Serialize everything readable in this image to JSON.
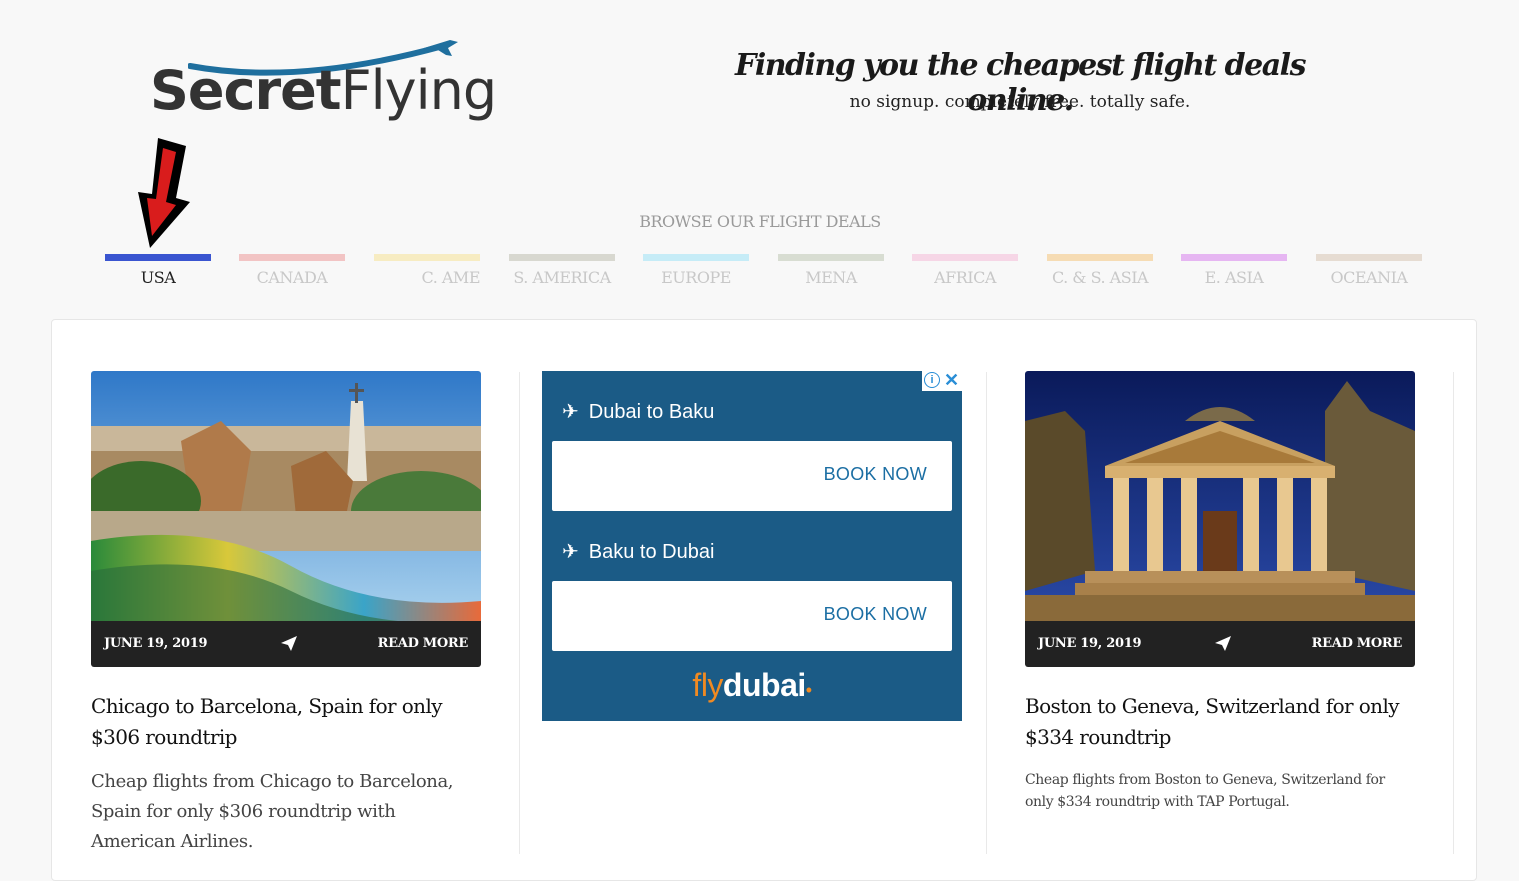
{
  "header": {
    "logo_part1": "Secret",
    "logo_part2": "Flying",
    "tagline": "Finding you the cheapest flight deals online.",
    "subtagline": "no signup. completely free. totally safe."
  },
  "browse_label": "BROWSE OUR FLIGHT DEALS",
  "regions": [
    {
      "label": "USA",
      "color": "#3a55d0",
      "active": true
    },
    {
      "label": "CANADA",
      "color": "#f2c4c4"
    },
    {
      "label": "C. AME",
      "color": "#f7ecc2"
    },
    {
      "label": "S. AMERICA",
      "color": "#d8d8d0"
    },
    {
      "label": "EUROPE",
      "color": "#c6ecf7"
    },
    {
      "label": "MENA",
      "color": "#d8ddd2"
    },
    {
      "label": "AFRICA",
      "color": "#f6d6e6"
    },
    {
      "label": "C. & S. ASIA",
      "color": "#f6dcb4"
    },
    {
      "label": "E. ASIA",
      "color": "#e6b6f2"
    },
    {
      "label": "OCEANIA",
      "color": "#e6dcd2"
    }
  ],
  "deals": [
    {
      "date": "JUNE 19, 2019",
      "read_more": "READ MORE",
      "title": "Chicago to Barcelona, Spain for only $306 roundtrip",
      "description": "Cheap flights from Chicago to Barcelona, Spain for only $306 roundtrip with American Airlines."
    },
    {
      "date": "JUNE 19, 2019",
      "read_more": "READ MORE",
      "title": "Boston to Geneva, Switzerland for only $334 roundtrip",
      "description": "Cheap flights from Boston to Geneva, Switzerland for only $334 roundtrip with TAP Portugal."
    }
  ],
  "ad": {
    "routes": [
      {
        "route": "Dubai to Baku",
        "cta": "BOOK NOW"
      },
      {
        "route": "Baku to Dubai",
        "cta": "BOOK NOW"
      }
    ],
    "brand_fly": "fly",
    "brand_dubai": "dubai",
    "colors": {
      "background": "#1b5b86",
      "brand_orange": "#f08a22"
    }
  },
  "icons": [
    "plane-swoosh-icon",
    "annotation-arrow-icon",
    "share-icon",
    "airplane-icon",
    "ad-info-icon",
    "ad-close-icon"
  ]
}
